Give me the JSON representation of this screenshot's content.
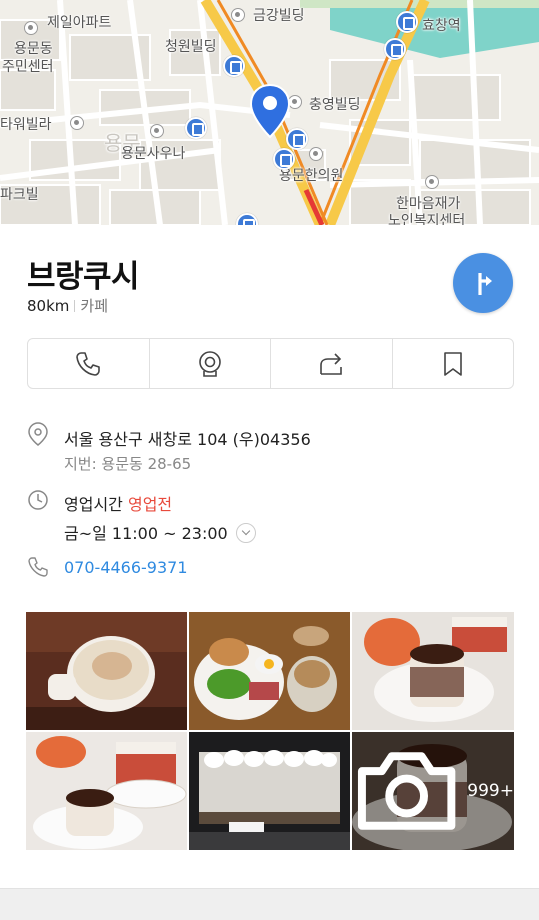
{
  "map": {
    "labels": {
      "jeil_apt": "제일아파트",
      "yongmun_dong": "용문동",
      "community_center": "주민센터",
      "cheongwon_bldg": "청원빌딩",
      "geumgang_bldg": "금강빌딩",
      "hyochang_stn": "효창역",
      "tower_villa": "타워빌라",
      "yongmun_sauna": "용문사우나",
      "chungyoung_bldg": "충영빌딩",
      "yongmun_clinic": "용문한의원",
      "park_villa": "파크빌",
      "hanmaeum_1": "한마음재가",
      "hanmaeum_2": "노인복지센터",
      "faded_yong": "용문"
    }
  },
  "place": {
    "name": "브랑쿠시",
    "distance": "80km",
    "category": "카페"
  },
  "address": {
    "road": "서울 용산구 새창로 104 (우)04356",
    "lot": "지번: 용문동 28-65"
  },
  "hours": {
    "label": "영업시간",
    "status": "영업전",
    "schedule": "금~일 11:00 ~ 23:00"
  },
  "phone": "070-4466-9371",
  "photos": {
    "more_count": "999+"
  },
  "colors": {
    "accent": "#4a90e2",
    "link": "#2f8ae0",
    "closed": "#e84a3c"
  }
}
